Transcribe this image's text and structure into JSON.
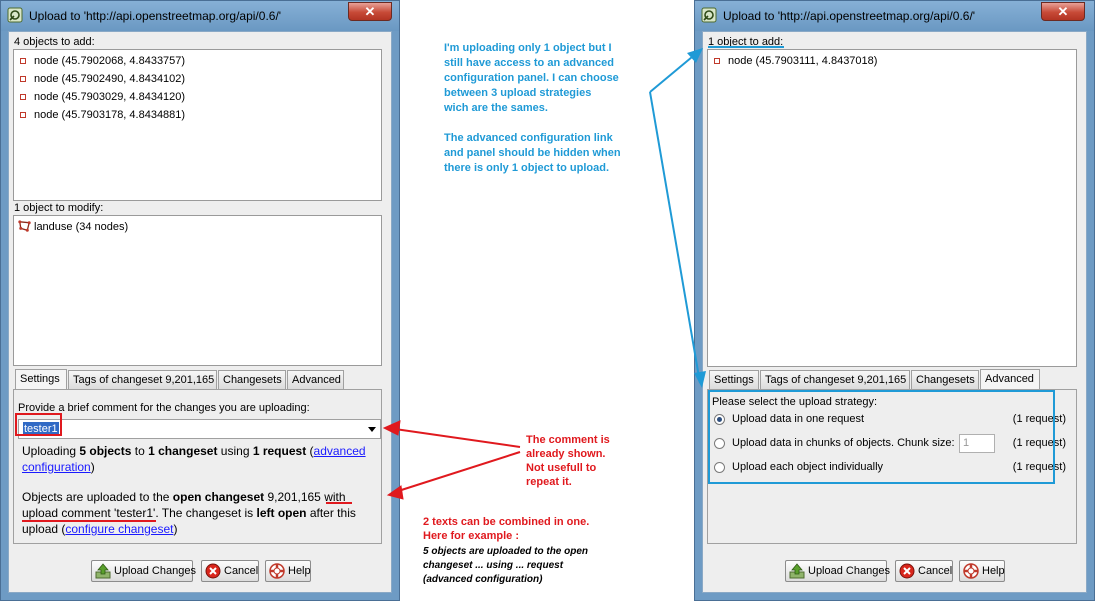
{
  "left_dialog": {
    "title": "Upload to 'http://api.openstreetmap.org/api/0.6/'",
    "close_symbol": "✕",
    "objects_to_add_label": "4 objects to add:",
    "nodes_added": [
      "node (45.7902068, 4.8433757)",
      "node (45.7902490, 4.8434102)",
      "node (45.7903029, 4.8434120)",
      "node (45.7903178, 4.8434881)"
    ],
    "objects_to_modify_label": "1 object to modify:",
    "modified_items": [
      "landuse (34 nodes)"
    ],
    "tabs": [
      "Settings",
      "Tags of changeset 9,201,165",
      "Changesets",
      "Advanced"
    ],
    "active_tab": "Settings",
    "settings": {
      "comment_prompt": "Provide a brief comment for the changes you are uploading:",
      "comment_value": "tester1",
      "summary1_prefix": "Uploading ",
      "summary1_objects": "5 objects",
      "summary1_to": " to ",
      "summary1_changesets": "1 changeset",
      "summary1_using": " using ",
      "summary1_requests": "1 request",
      "summary1_open_paren": " (",
      "summary1_link": "advanced configuration",
      "summary1_close_paren": ")",
      "summary2_prefix": "Objects are uploaded to the ",
      "summary2_bold1": "open changeset",
      "summary2_mid": " 9,201,165 with upload comment 'tester1'. The changeset is ",
      "summary2_bold2": "left open",
      "summary2_after": " after this upload (",
      "summary2_link": "configure changeset",
      "summary2_close": ")"
    },
    "buttons": {
      "upload": "Upload Changes",
      "cancel": "Cancel",
      "help": "Help"
    }
  },
  "right_dialog": {
    "title": "Upload to 'http://api.openstreetmap.org/api/0.6/'",
    "close_symbol": "✕",
    "objects_to_add_label": "1 object to add:",
    "nodes_added": [
      "node (45.7903111, 4.8437018)"
    ],
    "tabs": [
      "Settings",
      "Tags of changeset 9,201,165",
      "Changesets",
      "Advanced"
    ],
    "active_tab": "Advanced",
    "advanced": {
      "strategy_prompt": "Please select the upload strategy:",
      "options": [
        {
          "label": "Upload data in one request",
          "count": "(1 request)",
          "checked": true
        },
        {
          "label": "Upload data in chunks of objects. Chunk size:",
          "count": "(1 request)",
          "checked": false,
          "chunk_size": "1"
        },
        {
          "label": "Upload each object individually",
          "count": "(1 request)",
          "checked": false
        }
      ]
    },
    "buttons": {
      "upload": "Upload Changes",
      "cancel": "Cancel",
      "help": "Help"
    }
  },
  "annotations": {
    "blue_note": [
      "I'm uploading only 1 object but I",
      "still have access to an advanced",
      "configuration panel. I can choose",
      "between 3 upload strategies",
      "wich are the sames.",
      "",
      "The advanced configuration link",
      "and panel should be hidden when",
      "there is only 1 object to upload."
    ],
    "red_note_1": [
      "The comment is",
      "already shown.",
      "Not usefull to",
      "repeat it."
    ],
    "red_note_2": [
      "2 texts can be combined in one.",
      "Here for example :"
    ],
    "example_note": [
      "5 objects are uploaded to the open",
      "changeset ... using ... request",
      "(advanced configuration)"
    ]
  },
  "colors": {
    "annotation_blue": "#1f9ad6",
    "annotation_red": "#e0191e",
    "link": "#1a1aff"
  }
}
